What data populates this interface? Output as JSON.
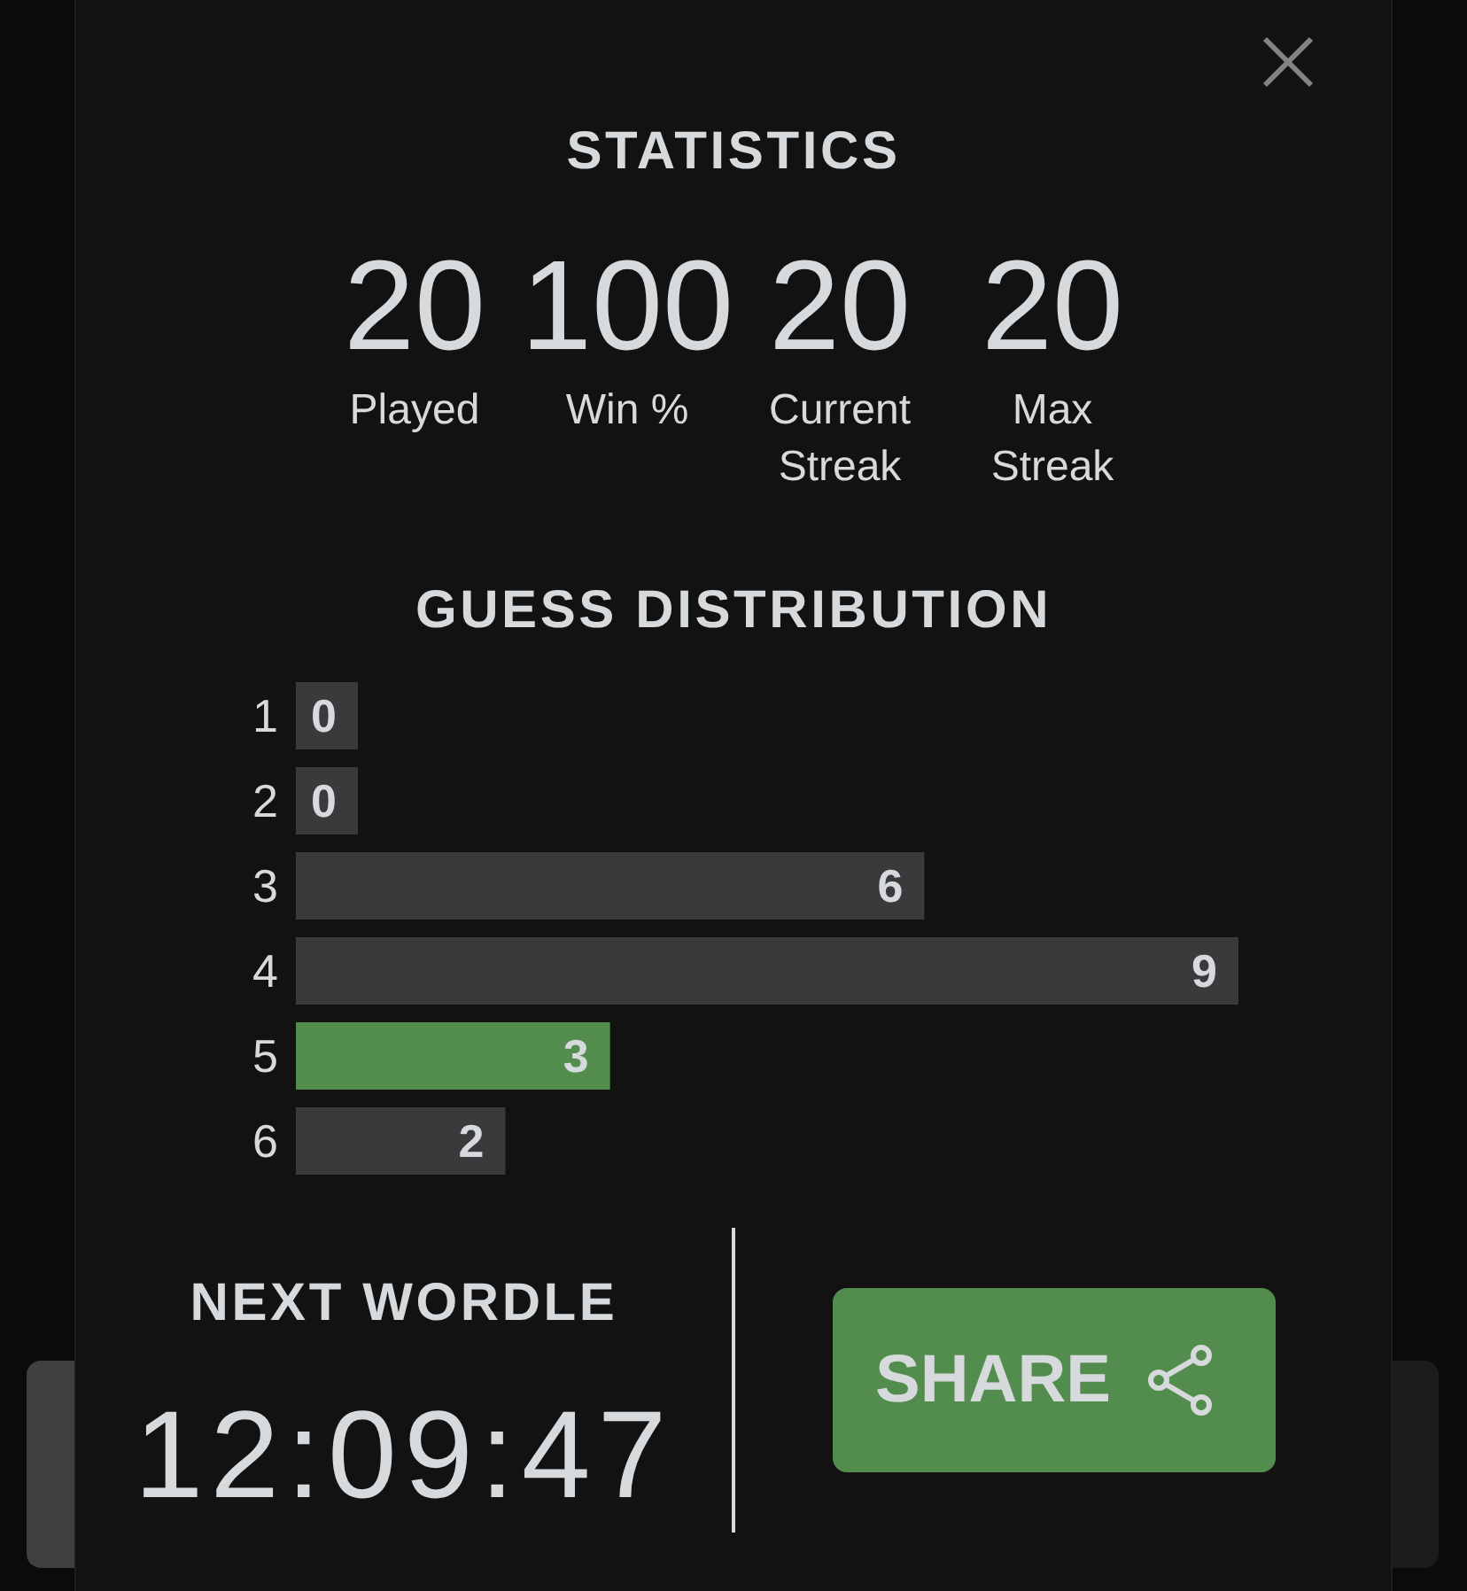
{
  "dialog": {
    "title": "STATISTICS"
  },
  "stats": [
    {
      "value": "20",
      "label": "Played"
    },
    {
      "value": "100",
      "label": "Win %"
    },
    {
      "value": "20",
      "label": "Current Streak"
    },
    {
      "value": "20",
      "label": "Max Streak"
    }
  ],
  "guess_distribution": {
    "title": "GUESS DISTRIBUTION",
    "chart_data": {
      "type": "bar",
      "orientation": "horizontal",
      "stacked": true,
      "categories": [
        "1",
        "2",
        "3",
        "4",
        "5",
        "6"
      ],
      "series": [
        {
          "color": "#3a3a3c",
          "values": [
            0,
            0,
            6,
            9,
            null,
            2
          ]
        },
        {
          "color": "#538d4e",
          "values": [
            null,
            null,
            null,
            null,
            3,
            null
          ]
        }
      ],
      "data_labels": true
    }
  },
  "next_wordle": {
    "title": "NEXT WORDLE",
    "countdown": "12:09:47"
  },
  "share_button": {
    "label": "SHARE"
  }
}
